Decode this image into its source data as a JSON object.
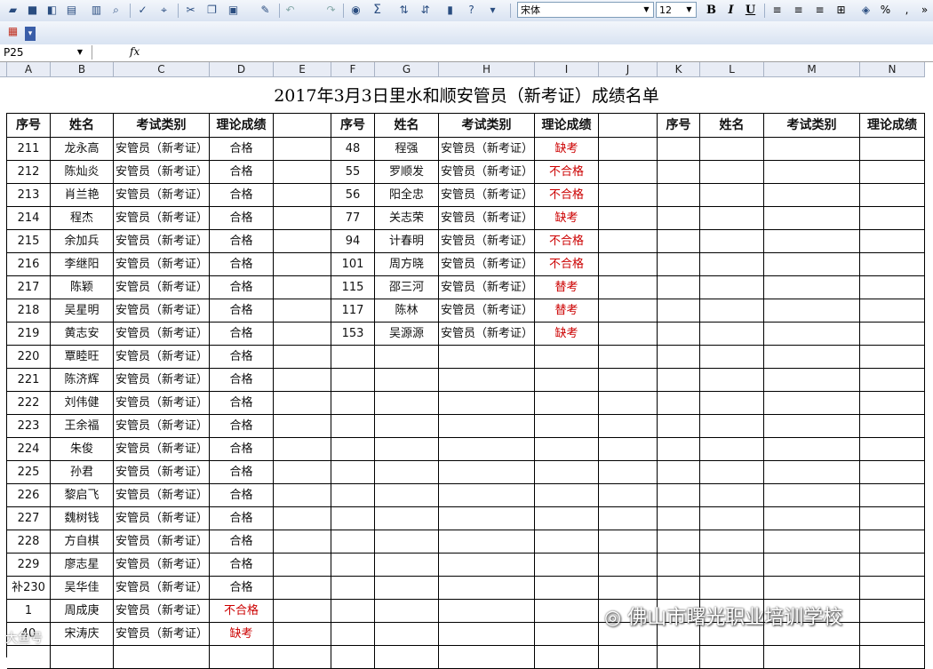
{
  "toolbar": {
    "font_name": "宋体",
    "font_size": "12",
    "bold": "B",
    "italic": "I",
    "underline": "U",
    "percent": "%",
    "sum": "Σ"
  },
  "formula_bar": {
    "name_box": "P25",
    "fx": "fx"
  },
  "columns": [
    "A",
    "B",
    "C",
    "D",
    "E",
    "F",
    "G",
    "H",
    "I",
    "J",
    "K",
    "L",
    "M",
    "N"
  ],
  "sheet": {
    "title": "2017年3月3日里水和顺安管员（新考证）成绩名单",
    "headers": [
      "序号",
      "姓名",
      "考试类别",
      "理论成绩"
    ],
    "left_rows": [
      [
        "211",
        "龙永高",
        "安管员（新考证）",
        "合格"
      ],
      [
        "212",
        "陈灿炎",
        "安管员（新考证）",
        "合格"
      ],
      [
        "213",
        "肖兰艳",
        "安管员（新考证）",
        "合格"
      ],
      [
        "214",
        "程杰",
        "安管员（新考证）",
        "合格"
      ],
      [
        "215",
        "余加兵",
        "安管员（新考证）",
        "合格"
      ],
      [
        "216",
        "李继阳",
        "安管员（新考证）",
        "合格"
      ],
      [
        "217",
        "陈颖",
        "安管员（新考证）",
        "合格"
      ],
      [
        "218",
        "吴星明",
        "安管员（新考证）",
        "合格"
      ],
      [
        "219",
        "黄志安",
        "安管员（新考证）",
        "合格"
      ],
      [
        "220",
        "覃睦旺",
        "安管员（新考证）",
        "合格"
      ],
      [
        "221",
        "陈济辉",
        "安管员（新考证）",
        "合格"
      ],
      [
        "222",
        "刘伟健",
        "安管员（新考证）",
        "合格"
      ],
      [
        "223",
        "王余福",
        "安管员（新考证）",
        "合格"
      ],
      [
        "224",
        "朱俊",
        "安管员（新考证）",
        "合格"
      ],
      [
        "225",
        "孙君",
        "安管员（新考证）",
        "合格"
      ],
      [
        "226",
        "黎启飞",
        "安管员（新考证）",
        "合格"
      ],
      [
        "227",
        "魏树钱",
        "安管员（新考证）",
        "合格"
      ],
      [
        "228",
        "方自棋",
        "安管员（新考证）",
        "合格"
      ],
      [
        "229",
        "廖志星",
        "安管员（新考证）",
        "合格"
      ],
      [
        "补230",
        "吴华佳",
        "安管员（新考证）",
        "合格"
      ],
      [
        "1",
        "周成庚",
        "安管员（新考证）",
        "不合格"
      ],
      [
        "40",
        "宋涛庆",
        "安管员（新考证）",
        "缺考"
      ]
    ],
    "middle_rows": [
      [
        "48",
        "程强",
        "安管员（新考证）",
        "缺考"
      ],
      [
        "55",
        "罗顺发",
        "安管员（新考证）",
        "不合格"
      ],
      [
        "56",
        "阳全忠",
        "安管员（新考证）",
        "不合格"
      ],
      [
        "77",
        "关志荣",
        "安管员（新考证）",
        "缺考"
      ],
      [
        "94",
        "计春明",
        "安管员（新考证）",
        "不合格"
      ],
      [
        "101",
        "周方晓",
        "安管员（新考证）",
        "不合格"
      ],
      [
        "115",
        "邵三河",
        "安管员（新考证）",
        "替考"
      ],
      [
        "117",
        "陈林",
        "安管员（新考证）",
        "替考"
      ],
      [
        "153",
        "吴源源",
        "安管员（新考证）",
        "缺考"
      ]
    ],
    "red_values": [
      "不合格",
      "缺考",
      "替考"
    ]
  },
  "watermark": {
    "text": "佛山市曙光职业培训学校",
    "corner": "大鱼号"
  },
  "colors": {
    "red": "#cc0000",
    "header_bg": "#e8ecf5"
  }
}
